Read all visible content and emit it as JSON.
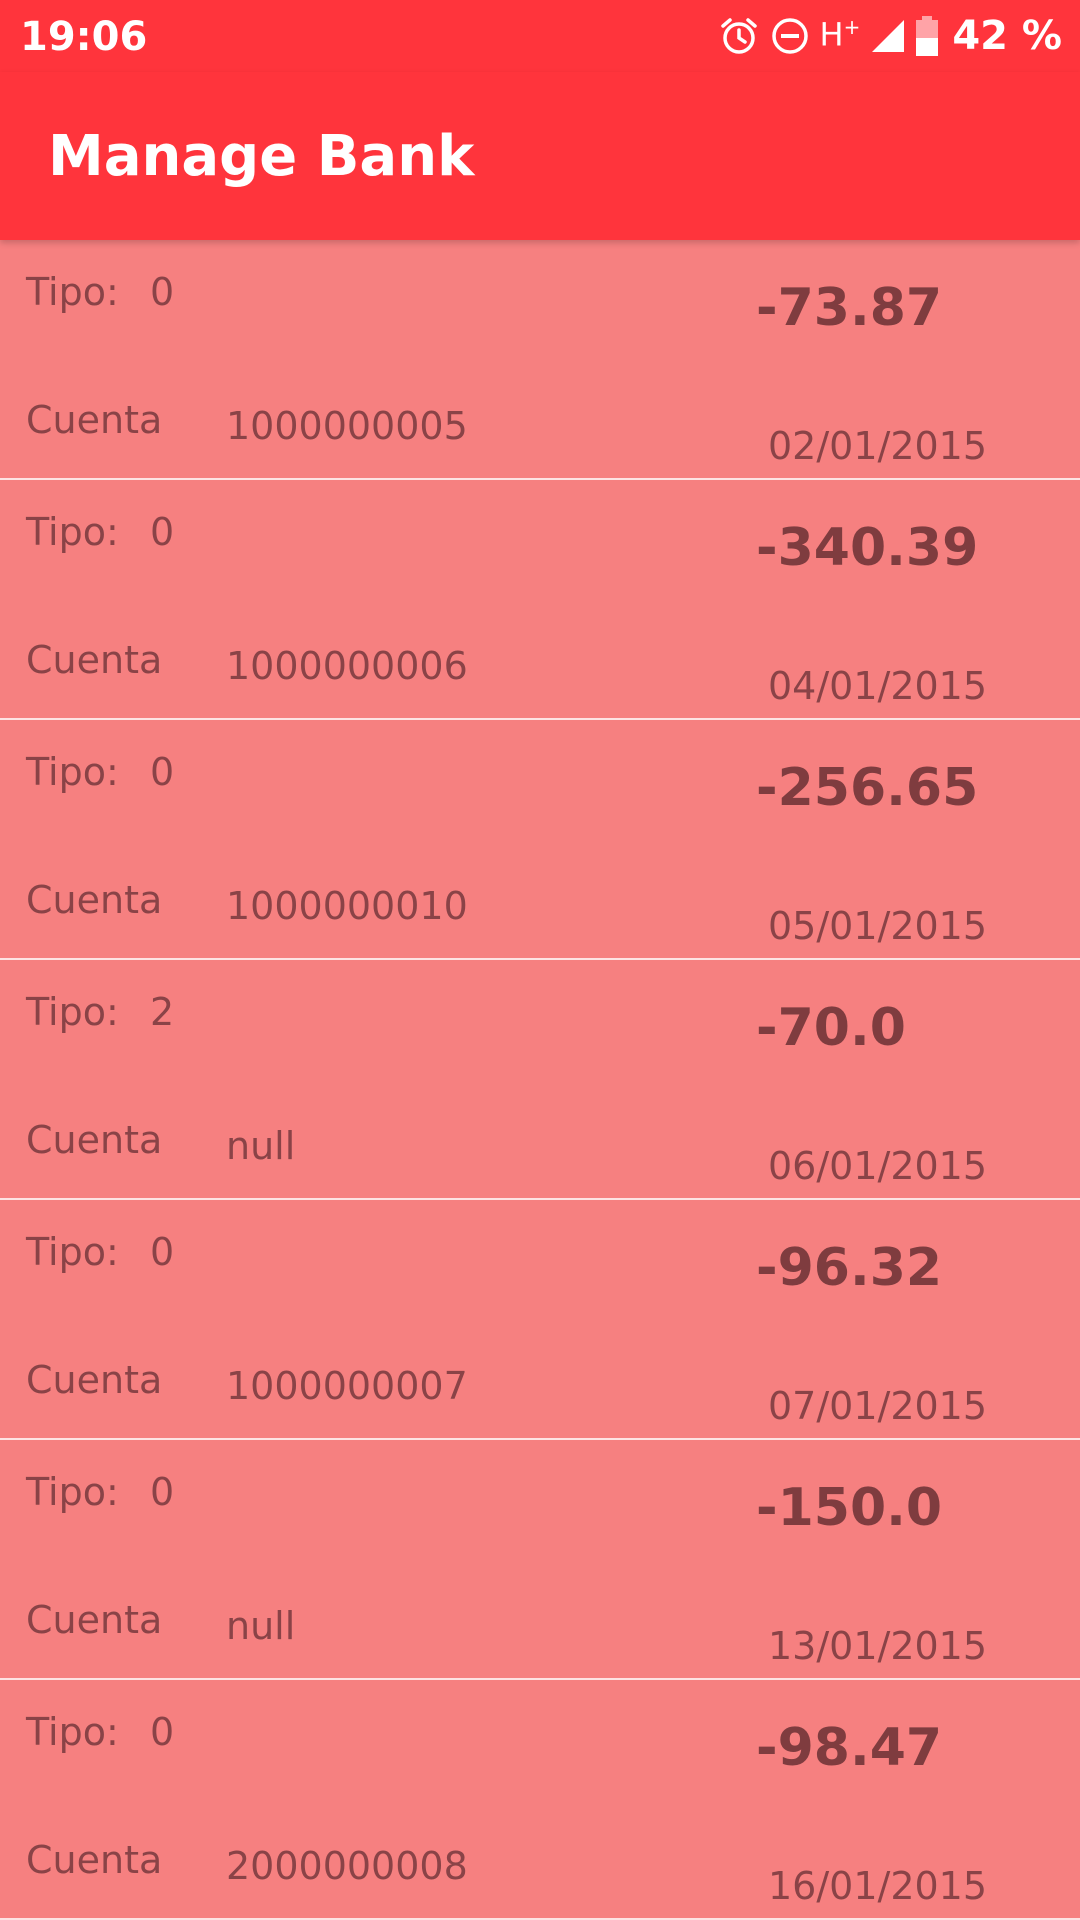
{
  "status_bar": {
    "time": "19:06",
    "network": "H",
    "network_suffix": "+",
    "battery": "42 %",
    "icons": [
      "alarm-icon",
      "do-not-disturb-icon",
      "signal-icon",
      "battery-icon"
    ]
  },
  "app_bar": {
    "title": "Manage Bank"
  },
  "colors": {
    "primary": "#ff343c",
    "row_background": "#f68080",
    "row_text": "#8a4347",
    "divider": "#fde3e3"
  },
  "transactions": [
    {
      "tipo_label": "Tipo:",
      "tipo": "0",
      "amount": "-73.87",
      "cuenta_label": "Cuenta",
      "cuenta": "1000000005",
      "date": "02/01/2015"
    },
    {
      "tipo_label": "Tipo:",
      "tipo": "0",
      "amount": "-340.39",
      "cuenta_label": "Cuenta",
      "cuenta": "1000000006",
      "date": "04/01/2015"
    },
    {
      "tipo_label": "Tipo:",
      "tipo": "0",
      "amount": "-256.65",
      "cuenta_label": "Cuenta",
      "cuenta": "1000000010",
      "date": "05/01/2015"
    },
    {
      "tipo_label": "Tipo:",
      "tipo": "2",
      "amount": "-70.0",
      "cuenta_label": "Cuenta",
      "cuenta": "null",
      "date": "06/01/2015"
    },
    {
      "tipo_label": "Tipo:",
      "tipo": "0",
      "amount": "-96.32",
      "cuenta_label": "Cuenta",
      "cuenta": "1000000007",
      "date": "07/01/2015"
    },
    {
      "tipo_label": "Tipo:",
      "tipo": "0",
      "amount": "-150.0",
      "cuenta_label": "Cuenta",
      "cuenta": "null",
      "date": "13/01/2015"
    },
    {
      "tipo_label": "Tipo:",
      "tipo": "0",
      "amount": "-98.47",
      "cuenta_label": "Cuenta",
      "cuenta": "2000000008",
      "date": "16/01/2015"
    }
  ]
}
